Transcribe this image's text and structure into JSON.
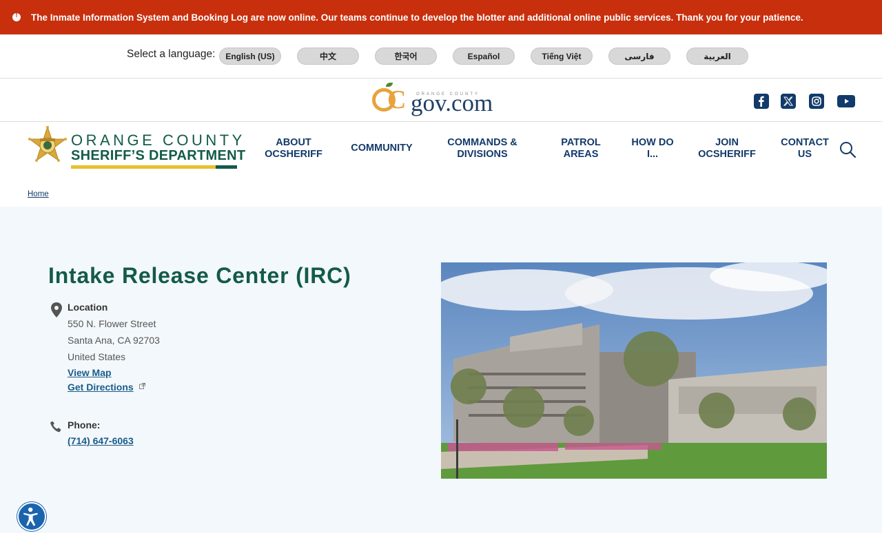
{
  "alert": {
    "text": "The Inmate Information System and Booking Log are now online. Our teams continue to develop the blotter and additional online public services. Thank you for your patience.",
    "color": "#c82f0d"
  },
  "language": {
    "label": "Select a language:",
    "options": [
      "English (US)",
      "中文",
      "한국어",
      "Español",
      "Tiếng Việt",
      "فارسی",
      "العربية"
    ]
  },
  "ocgov": {
    "small": "ORANGE COUNTY",
    "o": "O",
    "c": "C",
    "gov": "gov.com"
  },
  "social": {
    "icons": [
      "facebook-icon",
      "x-icon",
      "instagram-icon",
      "youtube-icon"
    ]
  },
  "sheriff_logo": {
    "line1": "ORANGE COUNTY",
    "line2": "SHERIFF’S DEPARTMENT"
  },
  "nav": {
    "items": [
      {
        "line1": "ABOUT",
        "line2": "OCSHERIFF"
      },
      {
        "line1": "COMMUNITY",
        "line2": ""
      },
      {
        "line1": "COMMANDS &",
        "line2": "DIVISIONS"
      },
      {
        "line1": "PATROL",
        "line2": "AREAS"
      },
      {
        "line1": "HOW DO",
        "line2": "I..."
      },
      {
        "line1": "JOIN",
        "line2": "OCSHERIFF"
      },
      {
        "line1": "CONTACT",
        "line2": "US"
      }
    ],
    "color": "#123a6a"
  },
  "breadcrumb": {
    "home": "Home"
  },
  "page": {
    "title": "Intake Release Center (IRC)",
    "location_label": "Location",
    "address": [
      "550 N. Flower Street",
      "Santa Ana, CA 92703",
      "United States"
    ],
    "view_map": "View Map",
    "get_directions": "Get Directions",
    "phone_label": "Phone:",
    "phone": "(714) 647-6063",
    "title_color": "#135b48"
  }
}
